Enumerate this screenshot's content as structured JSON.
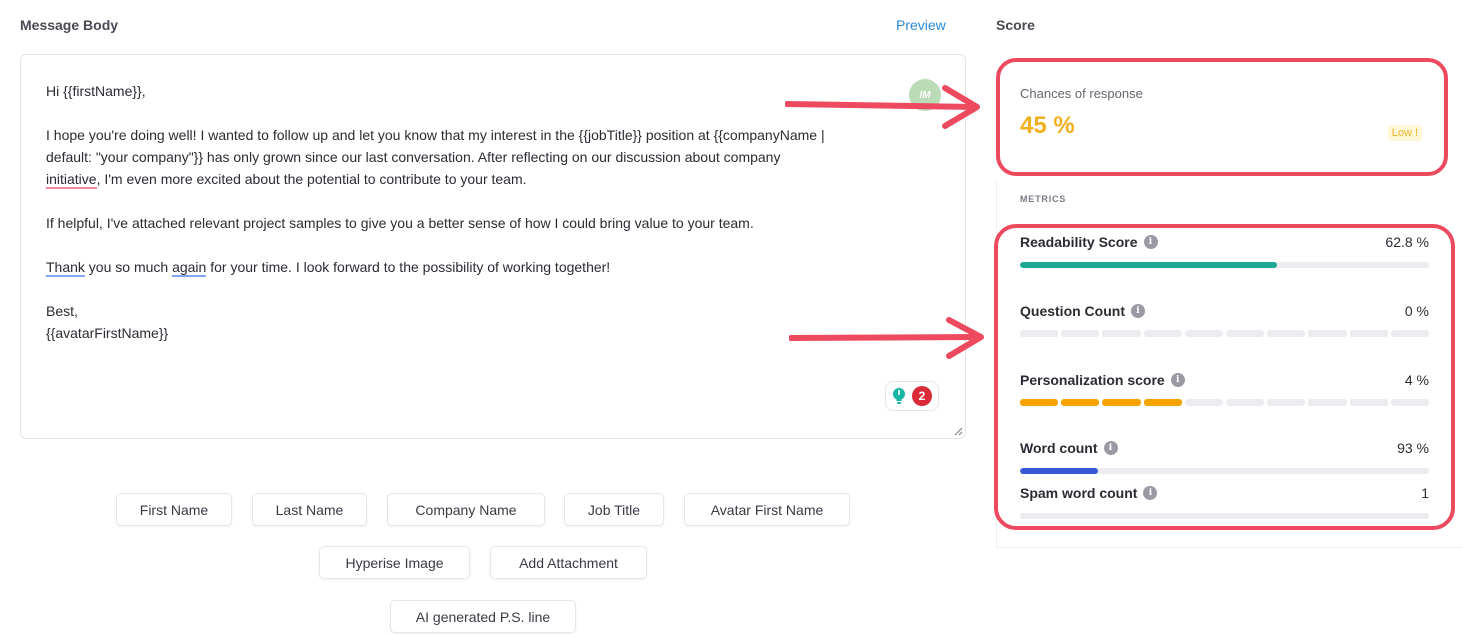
{
  "header": {
    "message_body_label": "Message Body",
    "preview_label": "Preview",
    "score_label": "Score"
  },
  "editor": {
    "avatar_initials": "IM",
    "line_greeting": "Hi {{firstName}},",
    "para1_a": "I hope you're doing well! I wanted to follow up and let you know that my interest in the {{jobTitle}} position at  {{companyName |",
    "para1_b": "default: \"your company\"}} has only grown since our last conversation. After reflecting on our discussion about company",
    "para1_c_word": "initiative",
    "para1_c_rest": ", I'm even more excited about the potential to contribute to your team.",
    "para2": "If helpful, I've attached relevant project samples to give you a better sense of how I could bring value to your team.",
    "para3_thank": "Thank",
    "para3_mid": " you so much ",
    "para3_again": "again",
    "para3_rest": " for your time. I look forward to the possibility of working together!",
    "signoff": "Best,",
    "signature": "{{avatarFirstName}}",
    "grammar_count": "2"
  },
  "insert_buttons": [
    {
      "label": "First Name"
    },
    {
      "label": "Last Name"
    },
    {
      "label": "Company Name"
    },
    {
      "label": "Job Title"
    },
    {
      "label": "Avatar First Name"
    },
    {
      "label": "Hyperise Image"
    },
    {
      "label": "Add Attachment"
    },
    {
      "label": "AI generated P.S. line"
    }
  ],
  "score": {
    "chances_label": "Chances of response",
    "chances_value": "45 %",
    "chances_badge": "Low !"
  },
  "metrics": {
    "heading": "METRICS",
    "items": [
      {
        "name": "Readability Score",
        "value": "62.8 %",
        "fraction": 0.628,
        "color": "#1ea896"
      },
      {
        "name": "Question Count",
        "value": "0 %",
        "segments_filled": 0,
        "segments_total": 10,
        "color": "#ebebf0"
      },
      {
        "name": "Personalization score",
        "value": "4 %",
        "segments_filled": 4,
        "segments_total": 10,
        "color": "#f5a300"
      },
      {
        "name": "Word count",
        "value": "93 %",
        "fraction": 0.19,
        "color": "#3559d6"
      },
      {
        "name": "Spam word count",
        "value": "1",
        "fraction": 0.0,
        "color": "#3559d6"
      }
    ]
  },
  "colors": {
    "annotation_red": "#ee4a5f",
    "accent_blue": "#2a8ad8",
    "score_yellow": "#f2b01e"
  }
}
